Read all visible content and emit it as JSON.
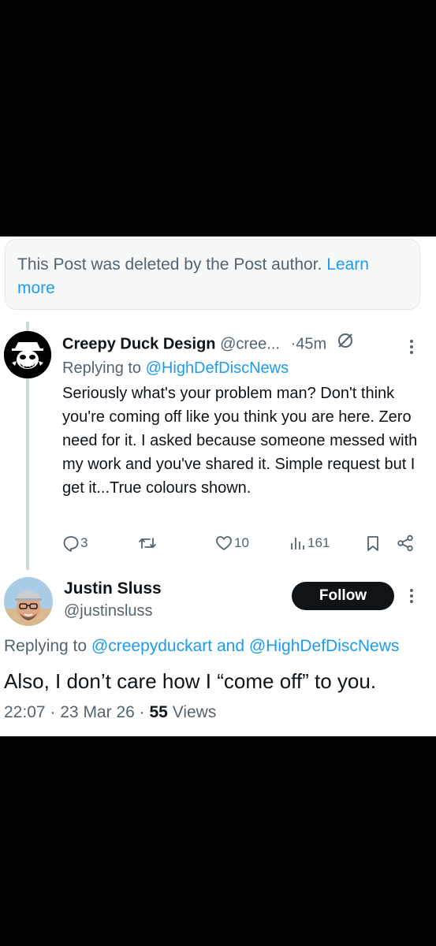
{
  "deleted_notice": {
    "text": "This Post was deleted by the Post author.",
    "link": "Learn more"
  },
  "reply_tweet": {
    "author_name": "Creepy Duck Design",
    "handle": "@cree...",
    "separator": "·",
    "time": "45m",
    "replying_prefix": "Replying to",
    "replying_to": "@HighDefDiscNews",
    "text": "Seriously what's your problem man? Don't think you're coming off like you think you are here. Zero need for it. I asked because someone messed with my work and you've shared it. Simple request but I get it...True colours shown.",
    "actions": {
      "replies": "3",
      "retweets": "",
      "likes": "10",
      "views": "161"
    },
    "icons": [
      "verified-slash-icon",
      "more-icon",
      "reply-icon",
      "retweet-icon",
      "like-icon",
      "views-icon",
      "bookmark-icon",
      "share-icon"
    ]
  },
  "main_tweet": {
    "author_name": "Justin Sluss",
    "handle": "@justinsluss",
    "follow_label": "Follow",
    "replying_prefix": "Replying to",
    "replying_user1": "@creepyduckart",
    "replying_and": "and",
    "replying_user2": "@HighDefDiscNews",
    "text": "Also, I don’t care how I “come off” to you.",
    "time": "22:07",
    "date": "23 Mar 26",
    "dot": "·",
    "views_count": "55",
    "views_label": "Views"
  },
  "colors": {
    "accent": "#1d9bf0",
    "text": "#0f1419",
    "muted": "#536471",
    "background": "#000000"
  }
}
